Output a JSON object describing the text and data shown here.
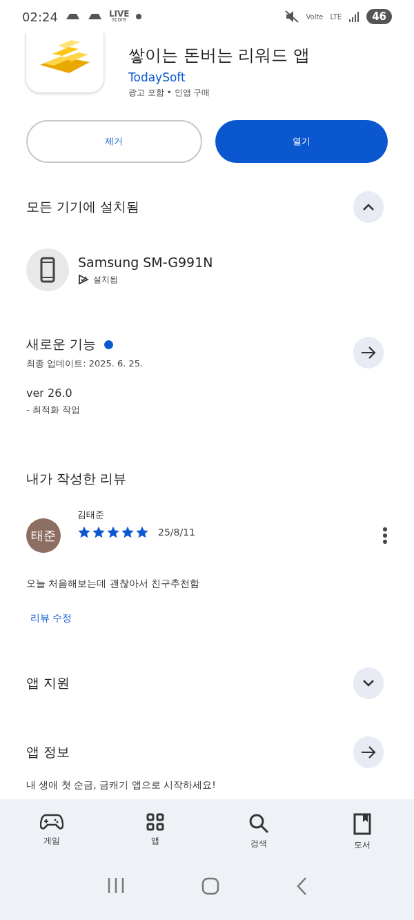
{
  "status_bar": {
    "time": "02:24",
    "live_logo": [
      "LIVE",
      "score"
    ],
    "volte": "Volte",
    "network": "LTE",
    "battery": "46"
  },
  "app": {
    "title": "쌓이는 돈버는 리워드 앱",
    "developer": "TodaySoft",
    "meta": "광고 포함 • 인앱 구매"
  },
  "buttons": [
    {
      "label": "제거",
      "kind": "outline"
    },
    {
      "label": "열기",
      "kind": "filled"
    }
  ],
  "installed": {
    "heading": "모든 기기에 설치됨",
    "expanded": true,
    "device": "Samsung SM-G991N",
    "status": "설치됨"
  },
  "whats_new": {
    "heading": "새로운 기능",
    "unread": true,
    "updated": "최종 업데이트: 2025. 6. 25.",
    "version": "ver 26.0",
    "notes": "- 최적화 작업"
  },
  "my_review": {
    "heading": "내가 작성한 리뷰",
    "author": "김태준",
    "avatar_text": "태준",
    "stars": 5,
    "date": "25/8/11",
    "text": "오늘 처음해보는데 괜찮아서 친구추천함",
    "edit": "리뷰 수정"
  },
  "app_support": {
    "heading": "앱 지원",
    "expanded": false
  },
  "app_info": {
    "heading": "앱 정보",
    "description": "내 생애 첫 순금, 금캐기 앱으로 시작하세요!"
  },
  "bottom_nav": [
    {
      "label": "게임",
      "selected": false
    },
    {
      "label": "앱",
      "selected": false
    },
    {
      "label": "검색",
      "selected": false
    },
    {
      "label": "도서",
      "selected": false
    }
  ]
}
